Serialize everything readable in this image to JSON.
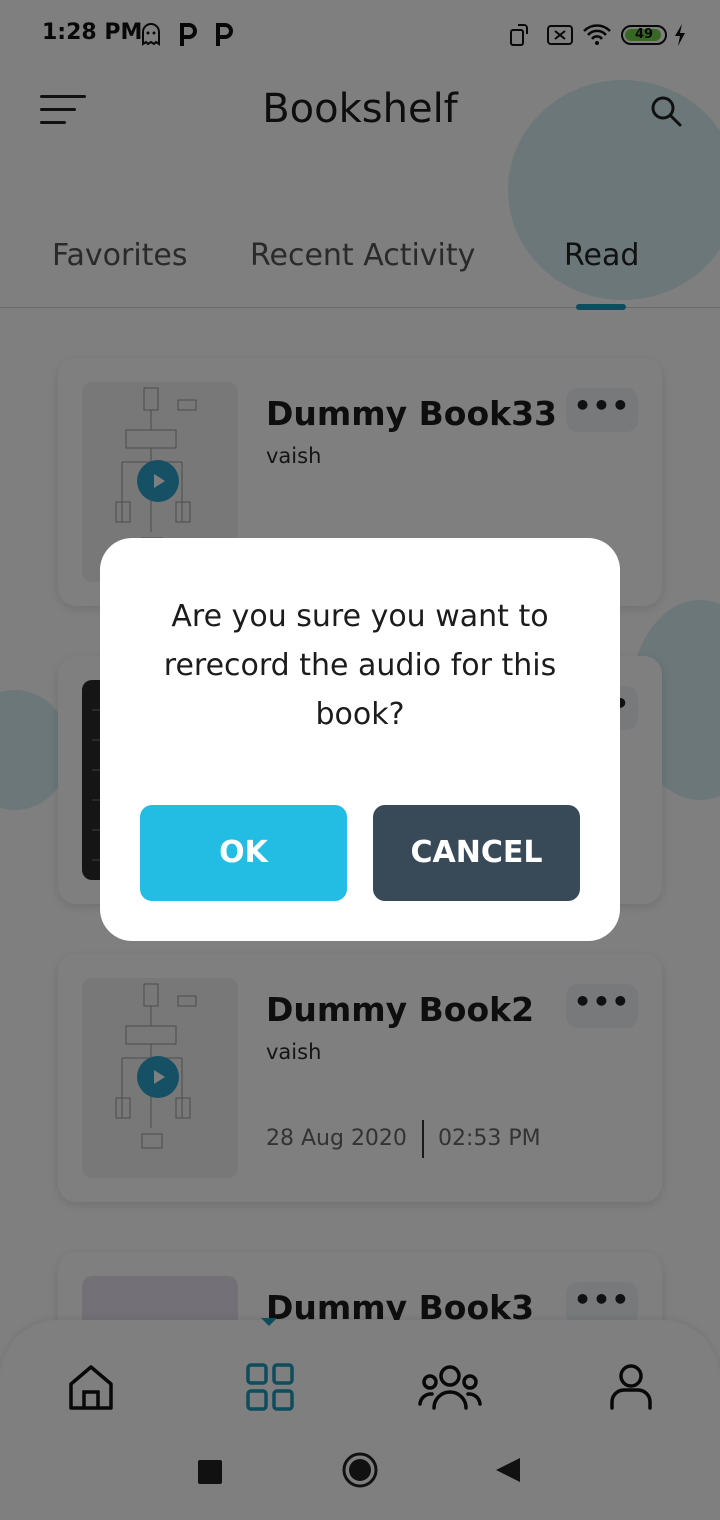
{
  "status_bar": {
    "time": "1:28 PM",
    "battery": "49"
  },
  "header": {
    "title": "Bookshelf"
  },
  "tabs": [
    {
      "label": "Favorites",
      "active": false
    },
    {
      "label": "Recent Activity",
      "active": false
    },
    {
      "label": "Read",
      "active": true
    }
  ],
  "books": [
    {
      "title": "Dummy Book33",
      "author": "vaish",
      "date": "",
      "time": ""
    },
    {
      "title": "",
      "author": "",
      "date": "",
      "time": ""
    },
    {
      "title": "Dummy Book2",
      "author": "vaish",
      "date": "28 Aug 2020",
      "time": "02:53 PM"
    },
    {
      "title": "Dummy Book3",
      "author": "",
      "date": "",
      "time": ""
    }
  ],
  "more_label": "•••",
  "dialog": {
    "message": "Are you sure you want to rerecord the audio for this book?",
    "ok_label": "OK",
    "cancel_label": "CANCEL"
  },
  "bottom_nav": {
    "items": [
      "home-icon",
      "grid-icon",
      "group-icon",
      "profile-icon"
    ],
    "active": "grid-icon"
  },
  "colors": {
    "accent": "#23bde4",
    "cancel": "#384957",
    "tab_indicator": "#1f98b8"
  }
}
